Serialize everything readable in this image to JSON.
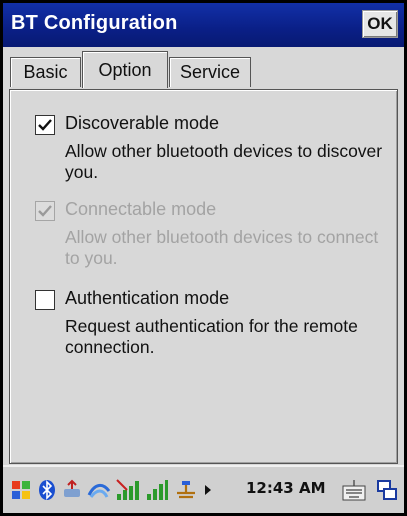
{
  "window": {
    "title": "BT Configuration",
    "ok_label": "OK"
  },
  "tabs": [
    {
      "label": "Basic",
      "active": false
    },
    {
      "label": "Option",
      "active": true
    },
    {
      "label": "Service",
      "active": false
    }
  ],
  "options": [
    {
      "label": "Discoverable mode",
      "description": "Allow other bluetooth devices to discover you.",
      "checked": true,
      "enabled": true
    },
    {
      "label": "Connectable mode",
      "description": "Allow other bluetooth devices to connect to you.",
      "checked": true,
      "enabled": false
    },
    {
      "label": "Authentication mode",
      "description": "Request authentication for the remote connection.",
      "checked": false,
      "enabled": true
    }
  ],
  "taskbar": {
    "clock": "12:43 AM",
    "icons": [
      "start-flag-icon",
      "bluetooth-icon",
      "usb-icon",
      "sync-icon",
      "signal-bars-icon",
      "signal-strength-icon",
      "connection-icon",
      "arrow-right-icon",
      "keyboard-icon",
      "windows-switch-icon"
    ]
  },
  "colors": {
    "titlebar": "#0a1f86",
    "background": "#d8d8d8",
    "disabled_text": "#a3a3a3"
  }
}
